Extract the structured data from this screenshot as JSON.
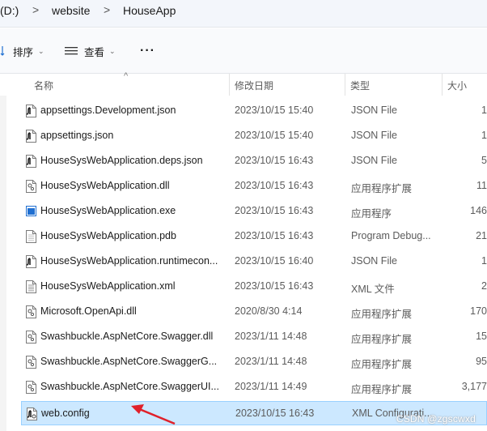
{
  "breadcrumb": {
    "drive": "(D:)",
    "folder1": "website",
    "folder2": "HouseApp",
    "separator": ">"
  },
  "toolbar": {
    "sort_label": "排序",
    "view_label": "查看",
    "more_label": "···"
  },
  "columns": {
    "name": "名称",
    "date": "修改日期",
    "type": "类型",
    "size": "大小"
  },
  "files": [
    {
      "name": "appsettings.Development.json",
      "date": "2023/10/15 15:40",
      "type": "JSON File",
      "size": "1",
      "icon": "json-file-icon"
    },
    {
      "name": "appsettings.json",
      "date": "2023/10/15 15:40",
      "type": "JSON File",
      "size": "1",
      "icon": "json-file-icon"
    },
    {
      "name": "HouseSysWebApplication.deps.json",
      "date": "2023/10/15 16:43",
      "type": "JSON File",
      "size": "5",
      "icon": "json-file-icon"
    },
    {
      "name": "HouseSysWebApplication.dll",
      "date": "2023/10/15 16:43",
      "type": "应用程序扩展",
      "size": "11",
      "icon": "dll-file-icon"
    },
    {
      "name": "HouseSysWebApplication.exe",
      "date": "2023/10/15 16:43",
      "type": "应用程序",
      "size": "146",
      "icon": "exe-file-icon"
    },
    {
      "name": "HouseSysWebApplication.pdb",
      "date": "2023/10/15 16:43",
      "type": "Program Debug...",
      "size": "21",
      "icon": "pdb-file-icon"
    },
    {
      "name": "HouseSysWebApplication.runtimecon...",
      "date": "2023/10/15 16:40",
      "type": "JSON File",
      "size": "1",
      "icon": "json-file-icon"
    },
    {
      "name": "HouseSysWebApplication.xml",
      "date": "2023/10/15 16:43",
      "type": "XML 文件",
      "size": "2",
      "icon": "xml-file-icon"
    },
    {
      "name": "Microsoft.OpenApi.dll",
      "date": "2020/8/30 4:14",
      "type": "应用程序扩展",
      "size": "170",
      "icon": "dll-file-icon"
    },
    {
      "name": "Swashbuckle.AspNetCore.Swagger.dll",
      "date": "2023/1/11 14:48",
      "type": "应用程序扩展",
      "size": "15",
      "icon": "dll-file-icon"
    },
    {
      "name": "Swashbuckle.AspNetCore.SwaggerG...",
      "date": "2023/1/11 14:48",
      "type": "应用程序扩展",
      "size": "95",
      "icon": "dll-file-icon"
    },
    {
      "name": "Swashbuckle.AspNetCore.SwaggerUI...",
      "date": "2023/1/11 14:49",
      "type": "应用程序扩展",
      "size": "3,177",
      "icon": "dll-file-icon"
    },
    {
      "name": "web.config",
      "date": "2023/10/15 16:43",
      "type": "XML Configurati...",
      "size": "",
      "icon": "config-file-icon",
      "selected": true
    }
  ],
  "watermark": "CSDN @zgscwxd",
  "colors": {
    "selection_bg": "#cce8ff",
    "selection_border": "#99d1ff",
    "annotation_arrow": "#e0202a",
    "exe_icon_blue": "#1f6fd1"
  }
}
